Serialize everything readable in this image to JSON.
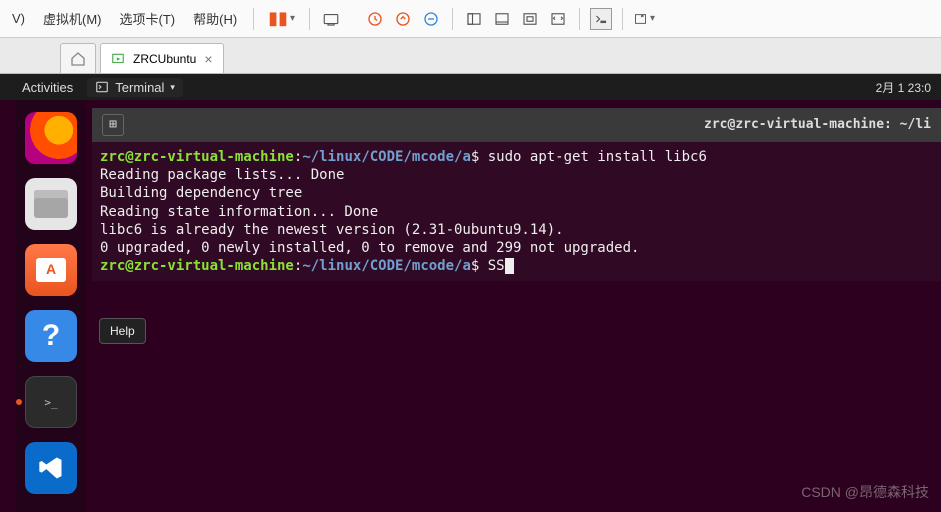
{
  "host_menu": {
    "items": [
      "V)",
      "虚拟机(M)",
      "选项卡(T)",
      "帮助(H)"
    ]
  },
  "tab": {
    "title": "ZRCUbuntu"
  },
  "panel": {
    "activities": "Activities",
    "app": "Terminal",
    "clock": "2月 1 23:0"
  },
  "dock": {
    "help_tooltip": "Help"
  },
  "terminal": {
    "title": "zrc@zrc-virtual-machine: ~/li",
    "prompt_user": "zrc@zrc-virtual-machine",
    "prompt_path": "~/linux/CODE/mcode/a",
    "cmd1": "sudo apt-get install libc6",
    "out1": "Reading package lists... Done",
    "out2": "Building dependency tree",
    "out3": "Reading state information... Done",
    "out4": "libc6 is already the newest version (2.31-0ubuntu9.14).",
    "out5": "0 upgraded, 0 newly installed, 0 to remove and 299 not upgraded.",
    "cmd2": "SS"
  },
  "watermark": "CSDN @昂德森科技"
}
